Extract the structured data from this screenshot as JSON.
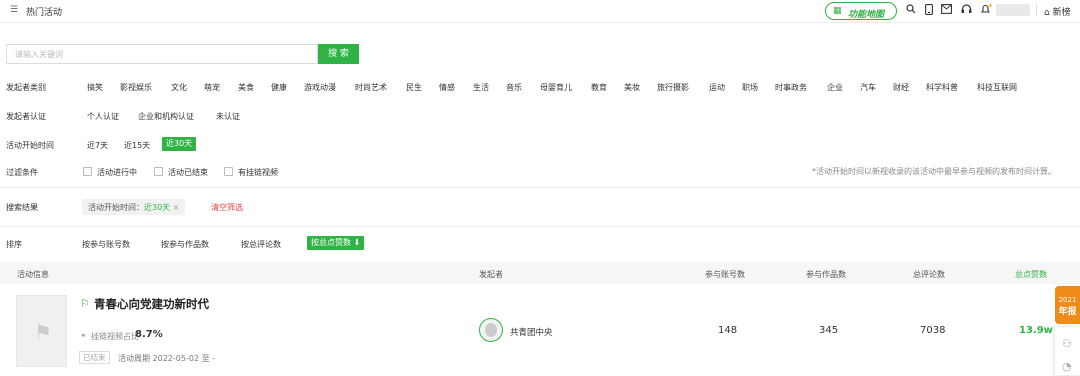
{
  "header": {
    "page_title": "热门活动",
    "feature_map_label": "功能地图",
    "home_label": "新榜"
  },
  "search": {
    "placeholder": "请输入关键词",
    "value": "",
    "button_label": "搜 索"
  },
  "filters": {
    "category_label": "发起者类别",
    "categories": [
      "搞笑",
      "影视娱乐",
      "文化",
      "萌宠",
      "美食",
      "健康",
      "游戏动漫",
      "时尚艺术",
      "民生",
      "情感",
      "生活",
      "音乐",
      "母婴育儿",
      "教育",
      "美妆",
      "旅行摄影",
      "运动",
      "职场",
      "时事政务",
      "企业",
      "汽车",
      "财经",
      "科学科普",
      "科技互联网"
    ],
    "cert_label": "发起者认证",
    "certs": [
      "个人认证",
      "企业和机构认证",
      "未认证"
    ],
    "time_label": "活动开始时间",
    "times": [
      "近7天",
      "近15天",
      "近30天"
    ],
    "time_selected": "近30天",
    "condition_label": "过滤条件",
    "conditions": [
      "活动进行中",
      "活动已结束",
      "有挂链视频"
    ],
    "note": "*活动开始时间以新视收录的该活动中最早参与视频的发布时间计算。"
  },
  "results": {
    "label": "搜索结果",
    "chip_prefix": "活动开始时间：",
    "chip_value": "近30天",
    "chip_close": "×",
    "clear_label": "清空筛选"
  },
  "sort": {
    "label": "排序",
    "options": [
      "按参与账号数",
      "按参与作品数",
      "按总评论数"
    ],
    "active": "按总点赞数 ⬇"
  },
  "table": {
    "headers": [
      "活动信息",
      "发起者",
      "参与账号数",
      "参与作品数",
      "总评论数",
      "总点赞数"
    ],
    "rows": [
      {
        "title": "青春心向党建功新时代",
        "link_label": "挂链视频占比",
        "link_ratio": "8.7%",
        "status": "已结束",
        "period": "活动周期 2022-05-02 至 -",
        "org": "共青团中央",
        "accounts": "148",
        "works": "345",
        "comments": "7038",
        "likes": "13.9w"
      }
    ]
  },
  "side": {
    "badge_year": "2021",
    "badge_text": "年报"
  },
  "colors": {
    "accent": "#2fb344",
    "danger": "#e8413c",
    "badge": "#f08a19"
  }
}
